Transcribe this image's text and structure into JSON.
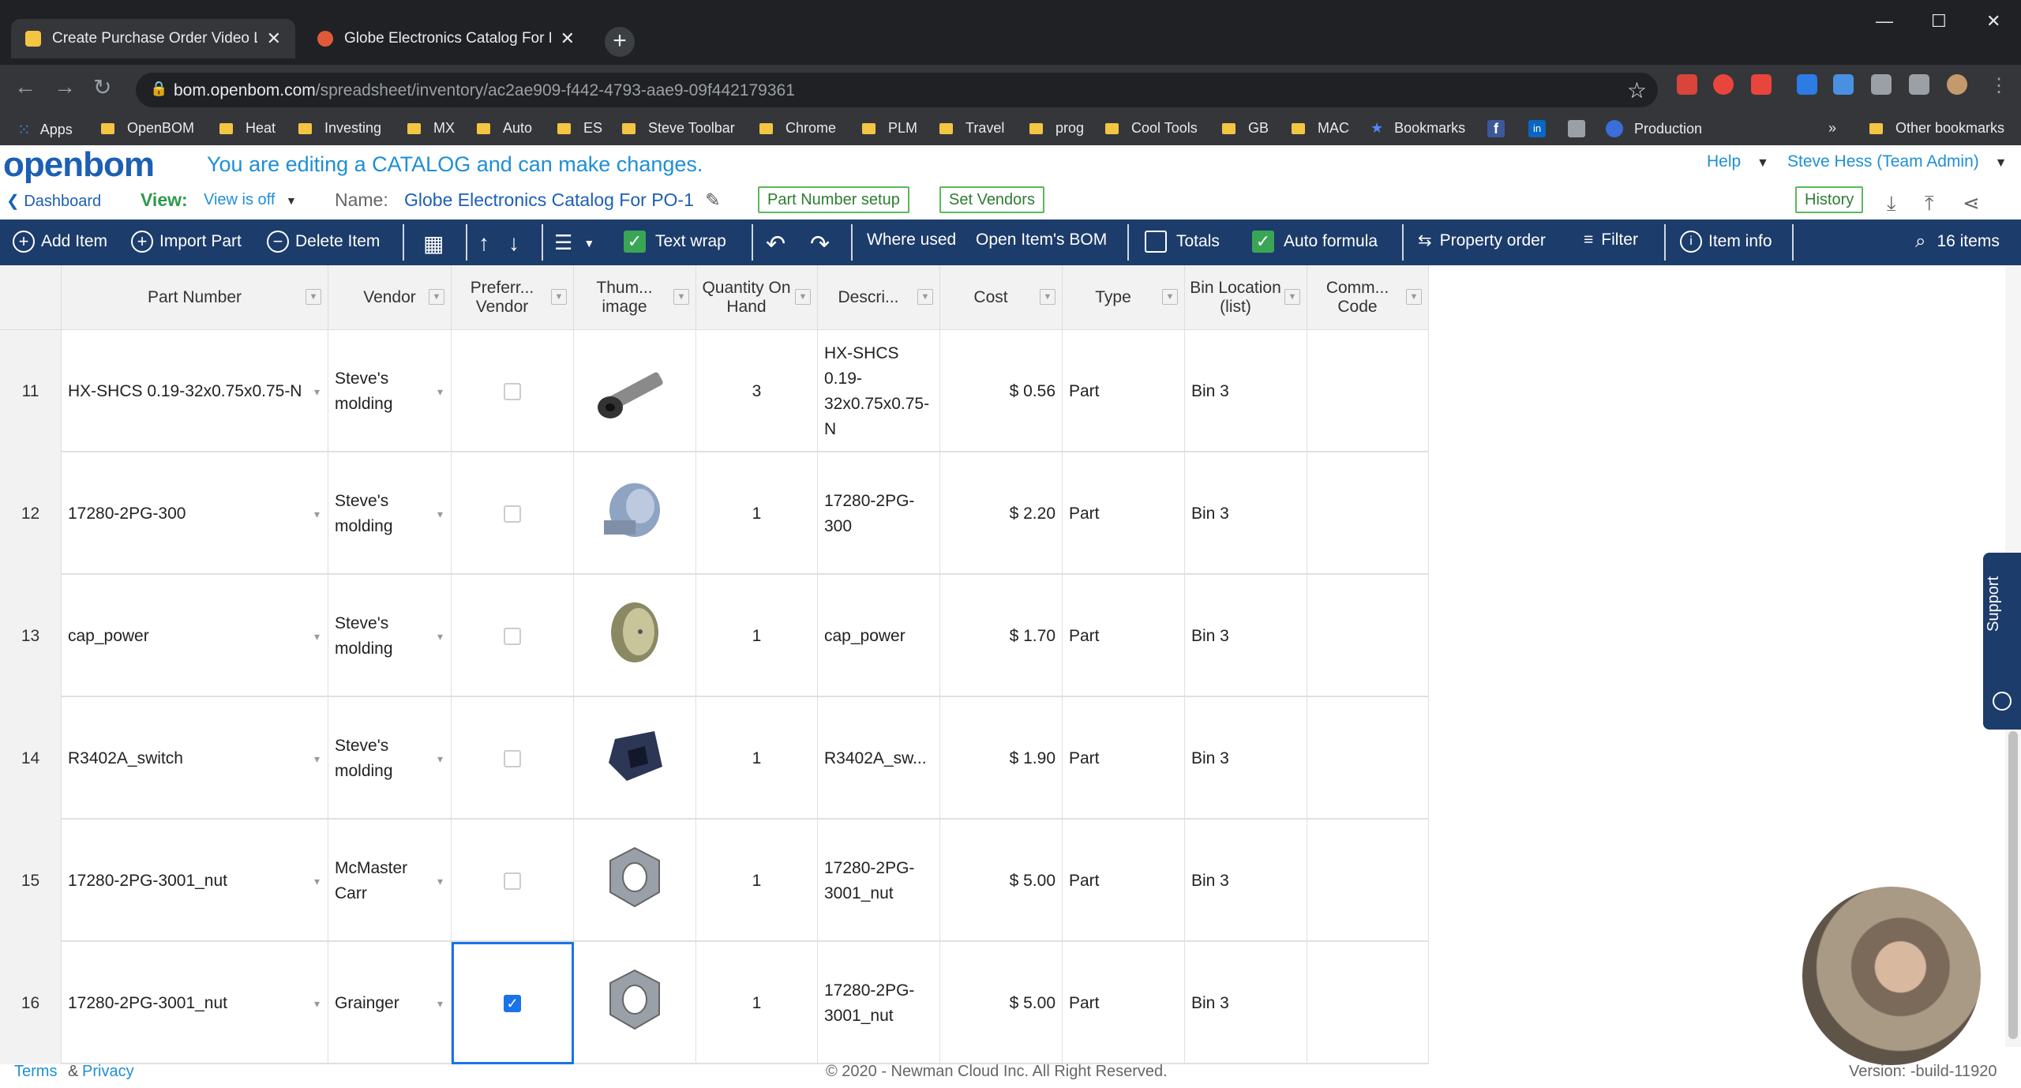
{
  "browser": {
    "tabs": [
      {
        "title": "Create Purchase Order Video Les",
        "color": "#f4c542"
      },
      {
        "title": "Globe Electronics Catalog For PO",
        "color": "#e05a3a"
      }
    ],
    "url_host": "bom.openbom.com",
    "url_path": "/spreadsheet/inventory/ac2ae909-f442-4793-aae9-09f442179361",
    "bookmarks": [
      "Apps",
      "OpenBOM",
      "Heat",
      "Investing",
      "MX",
      "Auto",
      "ES",
      "Steve Toolbar",
      "Chrome",
      "PLM",
      "Travel",
      "prog",
      "Cool Tools",
      "GB",
      "MAC",
      "Bookmarks",
      "Production"
    ],
    "overflow": "»",
    "other_bookmarks": "Other bookmarks"
  },
  "app": {
    "logo": "openbom",
    "edit_message": "You are editing a CATALOG and can make changes.",
    "help": "Help",
    "user": "Steve Hess (Team Admin)",
    "dashboard": "Dashboard",
    "view_label": "View:",
    "view_value": "View is off",
    "name_label": "Name:",
    "name_value": "Globe Electronics Catalog For PO-1",
    "part_number_setup": "Part Number setup",
    "set_vendors": "Set Vendors",
    "history": "History"
  },
  "toolbar": {
    "add_item": "Add Item",
    "import_part": "Import Part",
    "delete_item": "Delete Item",
    "text_wrap": "Text wrap",
    "where_used": "Where used",
    "open_bom": "Open Item's BOM",
    "totals": "Totals",
    "auto_formula": "Auto formula",
    "property_order": "Property order",
    "filter": "Filter",
    "item_info": "Item info",
    "item_count": "16 items"
  },
  "columns": [
    "Part Number",
    "Vendor",
    "Preferr... Vendor",
    "Thum... image",
    "Quantity On Hand",
    "Descri...",
    "Cost",
    "Type",
    "Bin Location (list)",
    "Comm... Code"
  ],
  "rows": [
    {
      "n": "11",
      "part": "HX-SHCS 0.19-32x0.75x0.75-N",
      "vendor": "Steve's molding",
      "preferred": false,
      "thumb": "screw-icon",
      "qty": "3",
      "desc": "HX-SHCS 0.19-32x0.75x0.75-N",
      "cost": "$ 0.56",
      "type": "Part",
      "bin": "Bin 3",
      "code": ""
    },
    {
      "n": "12",
      "part": "17280-2PG-300",
      "vendor": "Steve's molding",
      "preferred": false,
      "thumb": "standoff-icon",
      "qty": "1",
      "desc": "17280-2PG-300",
      "cost": "$ 2.20",
      "type": "Part",
      "bin": "Bin 3",
      "code": ""
    },
    {
      "n": "13",
      "part": "cap_power",
      "vendor": "Steve's molding",
      "preferred": false,
      "thumb": "cap-icon",
      "qty": "1",
      "desc": "cap_power",
      "cost": "$ 1.70",
      "type": "Part",
      "bin": "Bin 3",
      "code": ""
    },
    {
      "n": "14",
      "part": "R3402A_switch",
      "vendor": "Steve's molding",
      "preferred": false,
      "thumb": "switch-icon",
      "qty": "1",
      "desc": "R3402A_sw...",
      "cost": "$ 1.90",
      "type": "Part",
      "bin": "Bin 3",
      "code": ""
    },
    {
      "n": "15",
      "part": "17280-2PG-3001_nut",
      "vendor": "McMaster Carr",
      "preferred": false,
      "thumb": "nut-icon",
      "qty": "1",
      "desc": "17280-2PG-3001_nut",
      "cost": "$ 5.00",
      "type": "Part",
      "bin": "Bin 3",
      "code": ""
    },
    {
      "n": "16",
      "part": "17280-2PG-3001_nut",
      "vendor": "Grainger",
      "preferred": true,
      "thumb": "nut-icon",
      "qty": "1",
      "desc": "17280-2PG-3001_nut",
      "cost": "$ 5.00",
      "type": "Part",
      "bin": "Bin 3",
      "code": ""
    }
  ],
  "footer": {
    "terms": "Terms",
    "amp": "&",
    "privacy": "Privacy",
    "copyright": "© 2020 - Newman Cloud Inc. All Right Reserved.",
    "version": "Version: -build-11920"
  },
  "support": "Support",
  "colors": {
    "navy": "#1c3c6b",
    "brand": "#1c5fb5",
    "green": "#5cb85c"
  }
}
